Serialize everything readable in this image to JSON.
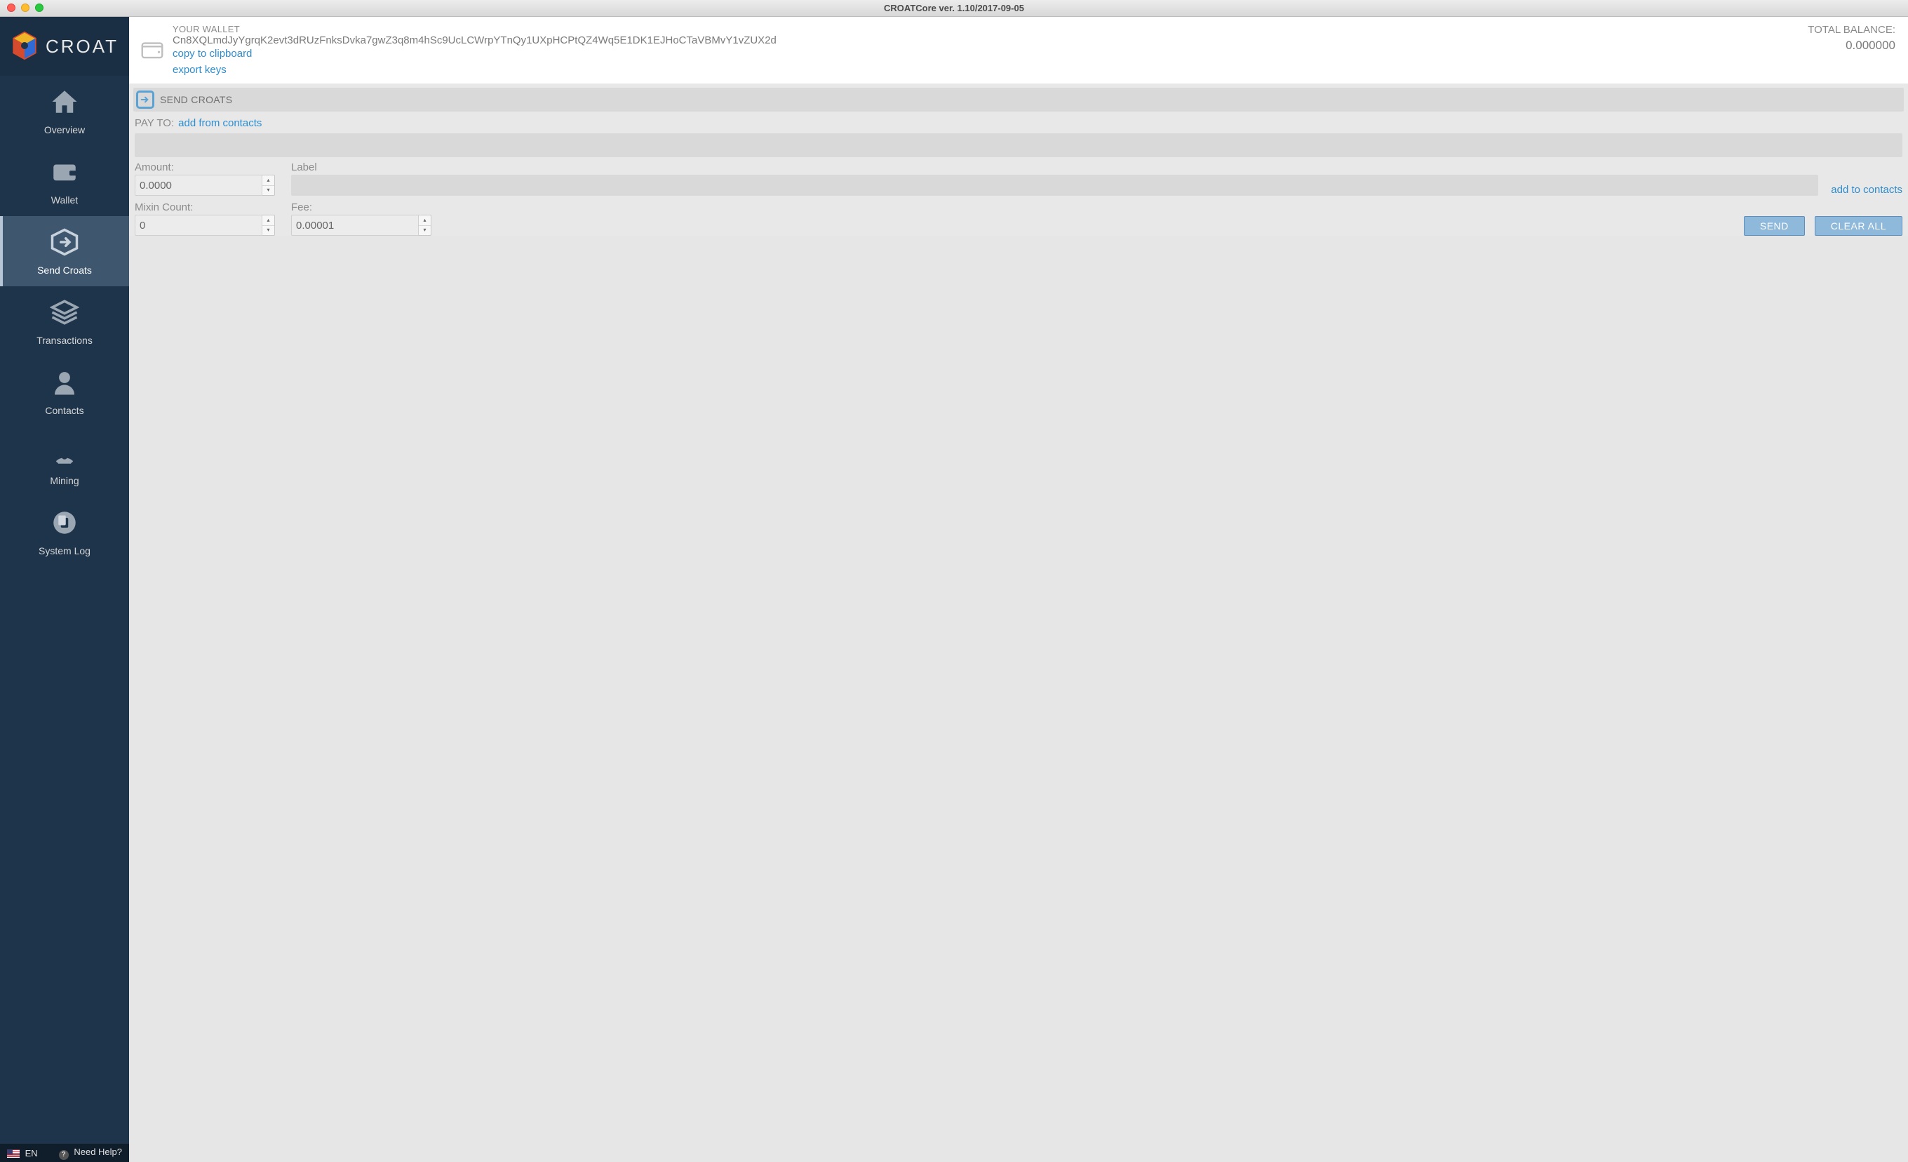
{
  "window": {
    "title": "CROATCore ver. 1.10/2017-09-05"
  },
  "brand": {
    "name": "CROAT"
  },
  "sidebar": {
    "items": [
      {
        "label": "Overview"
      },
      {
        "label": "Wallet"
      },
      {
        "label": "Send Croats"
      },
      {
        "label": "Transactions"
      },
      {
        "label": "Contacts"
      },
      {
        "label": "Mining"
      },
      {
        "label": "System Log"
      }
    ],
    "active_index": 2,
    "footer": {
      "language": "EN",
      "help": "Need Help?"
    }
  },
  "wallet": {
    "label": "YOUR WALLET",
    "address": "Cn8XQLmdJyYgrqK2evt3dRUzFnksDvka7gwZ3q8m4hSc9UcLCWrpYTnQy1UXpHCPtQZ4Wq5E1DK1EJHoCTaVBMvY1vZUX2d",
    "copy_link": "copy to clipboard",
    "export_link": "export keys",
    "balance_label": "TOTAL BALANCE:",
    "balance_value": "0.000000"
  },
  "section": {
    "title": "SEND CROATS"
  },
  "form": {
    "pay_to_label": "PAY TO:",
    "add_from_contacts": "add from contacts",
    "amount_label": "Amount:",
    "amount_value": "0.0000",
    "label_label": "Label",
    "label_value": "",
    "add_to_contacts": "add to contacts",
    "mixin_label": "Mixin Count:",
    "mixin_value": "0",
    "fee_label": "Fee:",
    "fee_value": "0.00001",
    "send_button": "SEND",
    "clear_button": "CLEAR ALL"
  }
}
